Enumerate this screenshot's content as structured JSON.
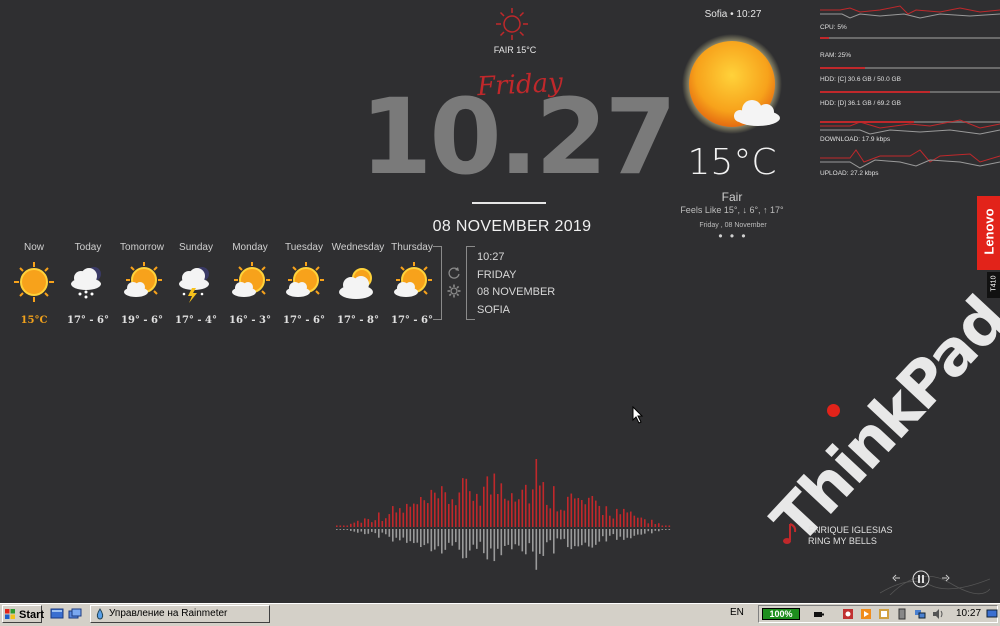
{
  "top_weather": {
    "condition": "FAIR 15°C",
    "day_script": "Friday"
  },
  "clock": {
    "time": "10.27",
    "date": "08 NOVEMBER 2019"
  },
  "forecast": [
    {
      "day": "Now",
      "temp": "15°C",
      "icon": "sun-icon"
    },
    {
      "day": "Today",
      "temp": "17° - 6°",
      "icon": "snow-cloud-icon"
    },
    {
      "day": "Tomorrow",
      "temp": "19° - 6°",
      "icon": "sun-cloud-icon"
    },
    {
      "day": "Sunday",
      "temp": "17° - 4°",
      "icon": "storm-cloud-icon"
    },
    {
      "day": "Monday",
      "temp": "16° - 3°",
      "icon": "sun-cloud-icon"
    },
    {
      "day": "Tuesday",
      "temp": "17° - 6°",
      "icon": "sun-cloud-icon"
    },
    {
      "day": "Wednesday",
      "temp": "17° - 8°",
      "icon": "cloud-sun-icon"
    },
    {
      "day": "Thursday",
      "temp": "17° - 6°",
      "icon": "sun-cloud-icon"
    }
  ],
  "info": {
    "time": "10:27",
    "day": "FRIDAY",
    "date": "08 NOVEMBER",
    "city": "SOFIA"
  },
  "weather": {
    "location_time": "Sofia • 10:27",
    "temp": "15°C",
    "condition": "Fair",
    "feels": "Feels Like 15°, ↓ 6°, ↑ 17°",
    "date": "Friday , 08 November",
    "dots": "• • •"
  },
  "stats": [
    {
      "label": "CPU: 5%",
      "value": 0.05
    },
    {
      "label": "RAM: 25%",
      "value": 0.25
    },
    {
      "label": "HDD: [C] 30.6 GB / 50.0 GB",
      "value": 0.61
    },
    {
      "label": "HDD: [D] 36.1 GB / 69.2 GB",
      "value": 0.52
    },
    {
      "label": "DOWNLOAD: 17.9 kbps",
      "value": 0.0
    },
    {
      "label": "UPLOAD: 27.2 kbps",
      "value": 0.0
    }
  ],
  "branding": {
    "lenovo": "Lenovo",
    "model": "T410",
    "thinkpad": "ThinkPad"
  },
  "music": {
    "artist": "ENRIQUE IGLESIAS",
    "track": "RING MY BELLS"
  },
  "taskbar": {
    "start": "Start",
    "window": "Управление на Rainmeter",
    "lang": "EN",
    "battery": "100%",
    "time": "10:27"
  },
  "colors": {
    "accent": "#c0282b",
    "sun": "#f2a21c",
    "lenovo": "#e2231a"
  }
}
